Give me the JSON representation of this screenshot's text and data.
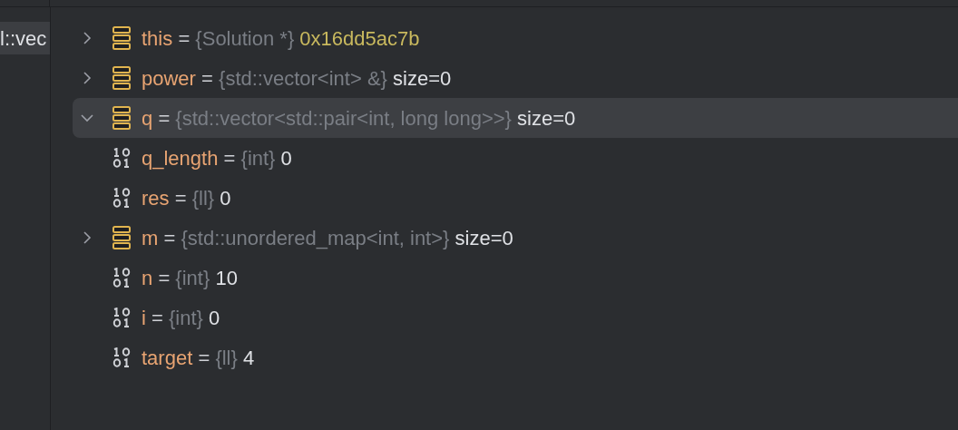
{
  "left_tab": {
    "label": "l::vec",
    "selected": true
  },
  "variables": [
    {
      "kind": "struct",
      "expanded": false,
      "selected": false,
      "name": "this",
      "separator": "=",
      "type": "{Solution *}",
      "value": "0x16dd5ac7b",
      "is_address": true
    },
    {
      "kind": "struct",
      "expanded": false,
      "selected": false,
      "name": "power",
      "separator": "=",
      "type": "{std::vector<int> &}",
      "value": "size=0",
      "is_address": false
    },
    {
      "kind": "struct",
      "expanded": true,
      "selected": true,
      "name": "q",
      "separator": "=",
      "type": "{std::vector<std::pair<int, long long>>}",
      "value": "size=0",
      "is_address": false
    },
    {
      "kind": "scalar",
      "selected": false,
      "name": "q_length",
      "separator": "=",
      "type": "{int}",
      "value": "0",
      "is_address": false
    },
    {
      "kind": "scalar",
      "selected": false,
      "name": "res",
      "separator": "=",
      "type": "{ll}",
      "value": "0",
      "is_address": false
    },
    {
      "kind": "struct",
      "expanded": false,
      "selected": false,
      "name": "m",
      "separator": "=",
      "type": "{std::unordered_map<int, int>}",
      "value": "size=0",
      "is_address": false
    },
    {
      "kind": "scalar",
      "selected": false,
      "name": "n",
      "separator": "=",
      "type": "{int}",
      "value": "10",
      "is_address": false
    },
    {
      "kind": "scalar",
      "selected": false,
      "name": "i",
      "separator": "=",
      "type": "{int}",
      "value": "0",
      "is_address": false
    },
    {
      "kind": "scalar",
      "selected": false,
      "name": "target",
      "separator": "=",
      "type": "{ll}",
      "value": "4",
      "is_address": false
    }
  ]
}
